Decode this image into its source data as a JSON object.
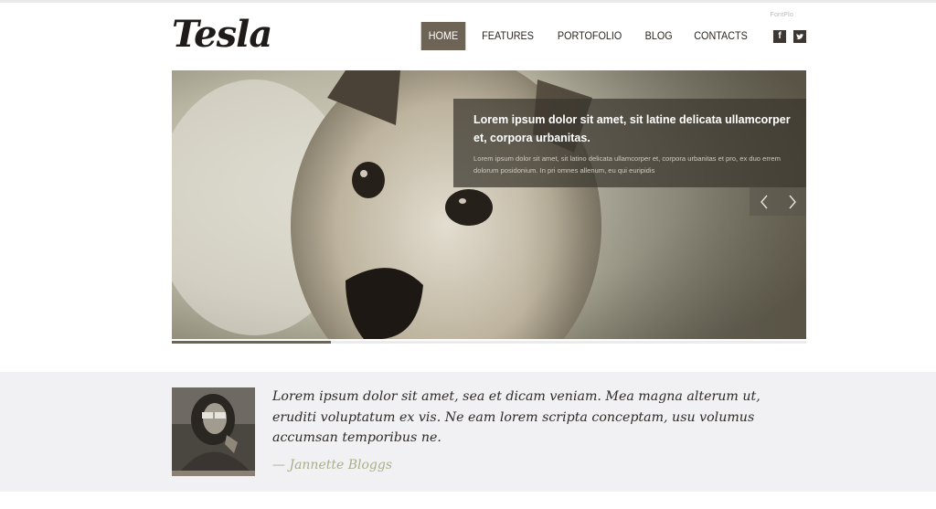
{
  "brand": {
    "logo_text": "Tesla"
  },
  "header": {
    "badge_text": "FontPlo"
  },
  "nav": {
    "items": [
      {
        "label": "HOME",
        "active": true
      },
      {
        "label": "FEATURES",
        "active": false
      },
      {
        "label": "PORTOFOLIO",
        "active": false
      },
      {
        "label": "BLOG",
        "active": false
      },
      {
        "label": "CONTACTS",
        "active": false
      }
    ],
    "social": {
      "facebook_glyph": "f",
      "facebook_icon": "facebook-icon",
      "twitter_icon": "twitter-icon"
    }
  },
  "slider": {
    "caption_title": "Lorem ipsum dolor sit amet, sit latine delicata ullamcorper et, corpora urbanitas.",
    "caption_text": "Lorem ipsum dolor sit amet, sit latino delicata ullamcorper et, corpora urbanitas et pro, ex duo errem dolorum posidonium. In pri omnes allenum, eu qui euripidis",
    "prev_icon": "chevron-left-icon",
    "next_icon": "chevron-right-icon",
    "progress": 0.25
  },
  "testimonial": {
    "quote": "Lorem ipsum dolor sit amet, sea et dicam veniam. Mea magna alterum ut, eruditi voluptatum ex vis. Ne eam lorem scripta conceptam, usu volumus accumsan temporibus ne.",
    "author": "— Jannette Bloggs"
  },
  "colors": {
    "accent": "#6e6456",
    "caption_bg": "#3a362e",
    "author": "#a8b08a",
    "band_bg": "#f1f0f3"
  }
}
